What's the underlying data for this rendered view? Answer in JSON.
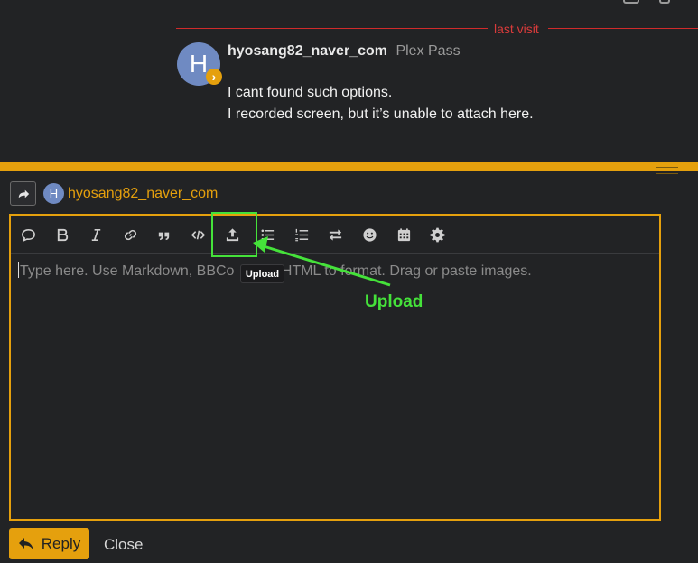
{
  "last_visit": {
    "label": "last visit",
    "color": "#d93b3b"
  },
  "post": {
    "avatar_letter": "H",
    "badge_symbol": "›",
    "username": "hyosang82_naver_com",
    "title": "Plex Pass",
    "body": [
      "I cant found such options.",
      "I recorded screen, but it’s unable to attach here."
    ]
  },
  "composer": {
    "avatar_letter": "H",
    "user": "hyosang82_naver_com",
    "toolbar": [
      {
        "name": "quote-icon"
      },
      {
        "name": "bold-icon"
      },
      {
        "name": "italic-icon"
      },
      {
        "name": "link-icon"
      },
      {
        "name": "blockquote-icon"
      },
      {
        "name": "code-icon"
      },
      {
        "name": "upload-icon"
      },
      {
        "name": "bullet-list-icon"
      },
      {
        "name": "numbered-list-icon"
      },
      {
        "name": "swap-icon"
      },
      {
        "name": "emoji-icon"
      },
      {
        "name": "calendar-icon"
      },
      {
        "name": "gear-icon"
      }
    ],
    "tooltip": "Upload",
    "placeholder": "Type here. Use Markdown, BBCode, or HTML to format. Drag or paste images.",
    "placeholder_visible_before": "Type here. Use Markdown, BBCo",
    "placeholder_visible_after": " HTML to format. Drag or paste images.",
    "annotation": "Upload",
    "reply_label": "Reply",
    "close_label": "Close"
  },
  "colors": {
    "accent": "#e5a00d",
    "annotation": "#45e23a",
    "background": "#222325"
  }
}
